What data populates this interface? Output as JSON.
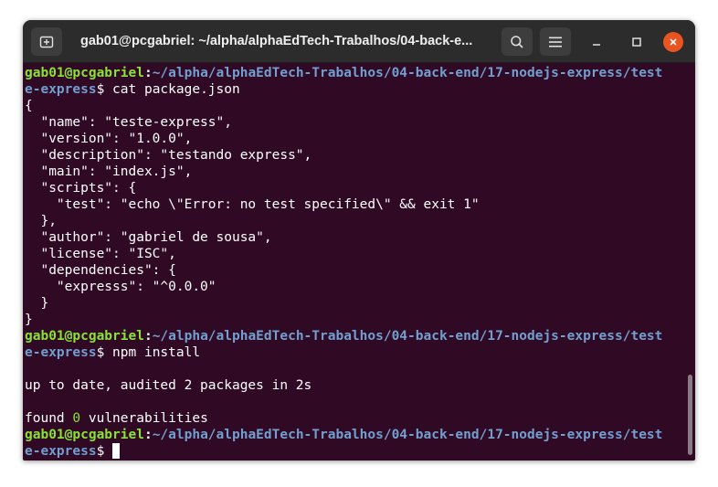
{
  "window": {
    "title": "gab01@pcgabriel: ~/alpha/alphaEdTech-Trabalhos/04-back-e...",
    "new_tab_icon": "new-tab-icon",
    "search_icon": "search-icon",
    "menu_icon": "hamburger-menu-icon",
    "accent_close": "#e95420"
  },
  "terminal": {
    "colors": {
      "background": "#300a24",
      "user": "#8ae234",
      "path": "#729fcf",
      "text": "#ffffff"
    },
    "user": "gab01@pcgabriel",
    "path_part1": "~/alpha/alphaEdTech-Trabalhos/04-back-end/17-nodejs-express/test",
    "path_part2": "e-express",
    "prompt_symbol": "$ ",
    "commands": [
      "cat package.json",
      "npm install",
      ""
    ],
    "json_lines": [
      "{",
      "  \"name\": \"teste-express\",",
      "  \"version\": \"1.0.0\",",
      "  \"description\": \"testando express\",",
      "  \"main\": \"index.js\",",
      "  \"scripts\": {",
      "    \"test\": \"echo \\\"Error: no test specified\\\" && exit 1\"",
      "  },",
      "  \"author\": \"gabriel de sousa\",",
      "  \"license\": \"ISC\",",
      "  \"dependencies\": {",
      "    \"expresss\": \"^0.0.0\"",
      "  }",
      "}"
    ],
    "npm_output": {
      "blank1": "",
      "line1": "up to date, audited 2 packages in 2s",
      "blank2": "",
      "found_prefix": "found ",
      "found_count": "0",
      "found_suffix": " vulnerabilities"
    }
  }
}
